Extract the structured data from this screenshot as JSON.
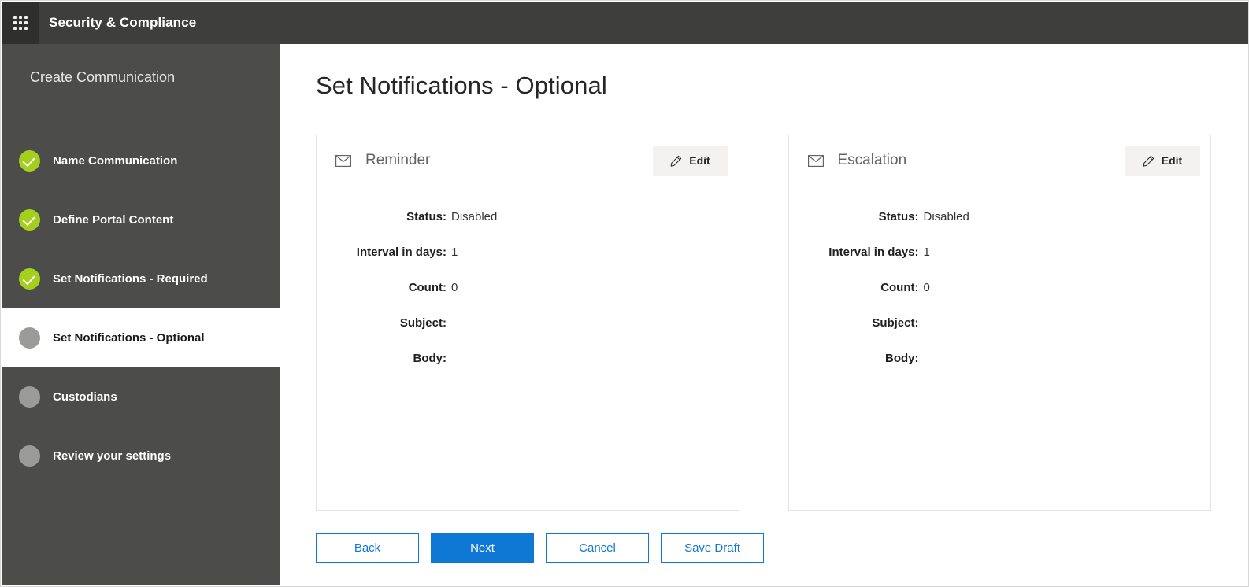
{
  "topbar": {
    "waffle_icon": "app-launcher-waffle-icon",
    "brand": "Security & Compliance"
  },
  "sidebar": {
    "title": "Create Communication",
    "items": [
      {
        "label": "Name Communication",
        "state": "done"
      },
      {
        "label": "Define Portal Content",
        "state": "done"
      },
      {
        "label": "Set Notifications - Required",
        "state": "done"
      },
      {
        "label": "Set Notifications - Optional",
        "state": "active"
      },
      {
        "label": "Custodians",
        "state": "pending"
      },
      {
        "label": "Review your settings",
        "state": "pending"
      }
    ]
  },
  "main": {
    "page_title": "Set Notifications - Optional",
    "cards": [
      {
        "icon": "envelope-icon",
        "title": "Reminder",
        "edit_label": "Edit",
        "fields": [
          {
            "label": "Status:",
            "value": "Disabled"
          },
          {
            "label": "Interval in days:",
            "value": "1"
          },
          {
            "label": "Count:",
            "value": "0"
          },
          {
            "label": "Subject:",
            "value": ""
          },
          {
            "label": "Body:",
            "value": ""
          }
        ]
      },
      {
        "icon": "envelope-icon",
        "title": "Escalation",
        "edit_label": "Edit",
        "fields": [
          {
            "label": "Status:",
            "value": "Disabled"
          },
          {
            "label": "Interval in days:",
            "value": "1"
          },
          {
            "label": "Count:",
            "value": "0"
          },
          {
            "label": "Subject:",
            "value": ""
          },
          {
            "label": "Body:",
            "value": ""
          }
        ]
      }
    ],
    "actions": [
      {
        "label": "Back",
        "style": "secondary"
      },
      {
        "label": "Next",
        "style": "primary"
      },
      {
        "label": "Cancel",
        "style": "secondary"
      },
      {
        "label": "Save Draft",
        "style": "secondary"
      }
    ]
  },
  "colors": {
    "topbar_bg": "#3e3e3c",
    "sidebar_bg": "#4c4c4a",
    "accent_green": "#a4cf1d",
    "accent_blue": "#0f78d4",
    "pending_gray": "#9b9b99"
  }
}
